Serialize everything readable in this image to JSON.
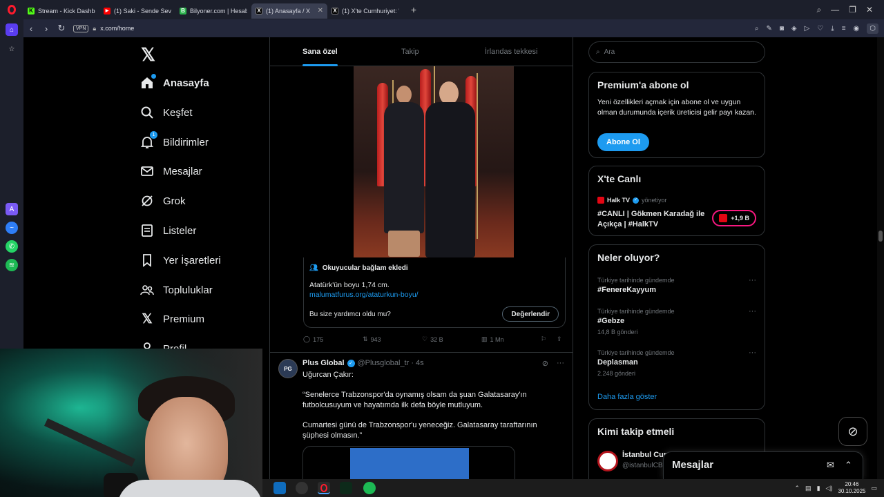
{
  "browser": {
    "tabs": [
      {
        "label": "Stream - Kick Dashboard",
        "fav_color": "#53fc18",
        "fav_glyph": "K"
      },
      {
        "label": "(1) Saki - Sende Sev Ama",
        "fav_color": "#ff0000",
        "fav_glyph": "▶"
      },
      {
        "label": "Bilyoner.com | Hesabım |",
        "fav_color": "#2bb24c",
        "fav_glyph": "B"
      },
      {
        "label": "(1) Anasayfa / X",
        "fav_color": "#e7e9ea",
        "fav_glyph": "X"
      },
      {
        "label": "(1) X'te Cumhuriyet: \"Saygı",
        "fav_color": "#e7e9ea",
        "fav_glyph": "X"
      }
    ],
    "url": "x.com/home",
    "vpn_label": "VPN"
  },
  "nav": {
    "items": [
      {
        "label": "Anasayfa",
        "icon": "home-icon"
      },
      {
        "label": "Keşfet",
        "icon": "search-icon"
      },
      {
        "label": "Bildirimler",
        "icon": "bell-icon",
        "badge": "1"
      },
      {
        "label": "Mesajlar",
        "icon": "mail-icon"
      },
      {
        "label": "Grok",
        "icon": "grok-icon"
      },
      {
        "label": "Listeler",
        "icon": "list-icon"
      },
      {
        "label": "Yer İşaretleri",
        "icon": "bookmark-icon"
      },
      {
        "label": "Topluluklar",
        "icon": "communities-icon"
      },
      {
        "label": "Premium",
        "icon": "x-icon"
      },
      {
        "label": "Profil",
        "icon": "profile-icon"
      }
    ]
  },
  "feed": {
    "tabs": [
      "Sana özel",
      "Takip",
      "İrlandas tekkesi"
    ],
    "community_note": {
      "header": "Okuyucular bağlam ekledi",
      "text": "Atatürk'ün boyu 1,74 cm.",
      "link": "malumatfurus.org/ataturkun-boyu/",
      "question": "Bu size yardımcı oldu mu?",
      "rate_label": "Değerlendir"
    },
    "actions": {
      "replies": "175",
      "reposts": "943",
      "likes": "32 B",
      "views": "1 Mn"
    },
    "tweet2": {
      "avatar": "PG",
      "name": "Plus Global",
      "handle": "@Plusglobal_tr · 4s",
      "line1": "Uğurcan Çakır:",
      "line2": "“Senelerce Trabzonspor'da oynamış olsam da şuan Galatasaray'ın futbolcusuyum ve hayatımda ilk defa böyle mutluyum.",
      "line3": "Cumartesi günü de Trabzonspor'u yeneceğiz. Galatasaray taraftarının şüphesi olmasın.”"
    }
  },
  "right": {
    "search_placeholder": "Ara",
    "premium": {
      "title": "Premium'a abone ol",
      "desc": "Yeni özellikleri açmak için abone ol ve uygun olman durumunda içerik üreticisi gelir payı kazan.",
      "button": "Abone Ol"
    },
    "live": {
      "title": "X'te Canlı",
      "host": "Halk TV",
      "host_role": "yönetiyor",
      "stream_title": "#CANLI | Gökmen Karadağ ile Açıkça | #HalkTV",
      "listeners": "+1,9 B"
    },
    "trends": {
      "title": "Neler oluyor?",
      "items": [
        {
          "meta": "Türkiye tarihinde gündemde",
          "name": "#FenereKayyum",
          "count": ""
        },
        {
          "meta": "Türkiye tarihinde gündemde",
          "name": "#Gebze",
          "count": "14,8 B gönderi"
        },
        {
          "meta": "Türkiye tarihinde gündemde",
          "name": "Deplasman",
          "count": "2.248 gönderi"
        }
      ],
      "more": "Daha fazla göster"
    },
    "follow": {
      "title": "Kimi takip etmeli",
      "name": "İstanbul Cum",
      "handle": "@istanbulCB"
    }
  },
  "messages_drawer": {
    "title": "Mesajlar"
  },
  "taskbar": {
    "time": "20:46",
    "date": "30.10.2025"
  },
  "colors": {
    "accent": "#1d9bf0",
    "background": "#000000",
    "border": "#2f3336",
    "muted": "#71767b",
    "live": "#f91880"
  }
}
